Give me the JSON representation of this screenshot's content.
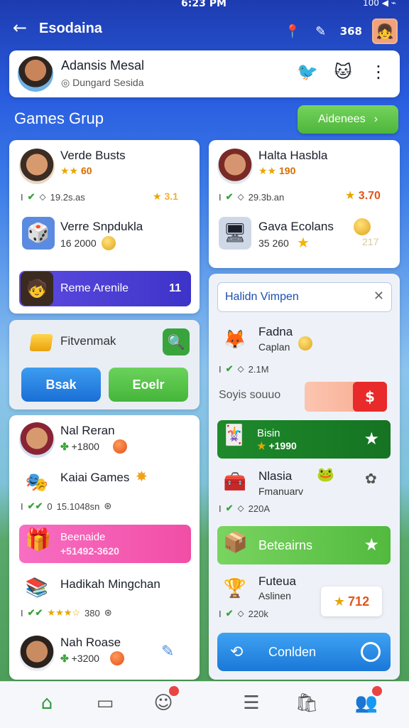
{
  "status_bar": {
    "time": "6:23 PM",
    "right": "100 ◀ ⌁"
  },
  "appbar": {
    "title": "Esodaina",
    "count": "368"
  },
  "profile": {
    "name": "Adansis Mesal",
    "subtitle": "Dungard Sesida"
  },
  "section": {
    "title": "Games Grup",
    "see_all_label": "Aidenees"
  },
  "left_card1": {
    "user1": {
      "name": "Verde Busts",
      "rating": "60",
      "meta": "19.2s.as",
      "score": "3.1"
    },
    "item2": {
      "name": "Verre Snpdukla",
      "value": "16 2000"
    },
    "button": {
      "label": "Reme Arenile",
      "count": "11"
    }
  },
  "right_card1": {
    "user1": {
      "name": "Halta Hasbla",
      "rating": "190",
      "meta": "29.3b.an",
      "score": "3.70"
    },
    "item2": {
      "name": "Gava Ecolans",
      "value": "35 260",
      "score": "217"
    }
  },
  "search_card": {
    "label": "Fitvenmak",
    "btn_blue": "Bsak",
    "btn_green": "Eoelr"
  },
  "left_card2": {
    "user1": {
      "name": "Nal Reran",
      "value": "+1800"
    },
    "item2": {
      "name": "Kaiai Games",
      "meta": "15.1048sn"
    },
    "banner": {
      "title": "Beenaide",
      "sub": "+51492-3620"
    },
    "item3": {
      "name": "Hadikah Mingchan",
      "meta": "380"
    },
    "user2": {
      "name": "Nah Roase",
      "value": "+3200"
    }
  },
  "right_panel": {
    "search_text": "Halidn Vimpen",
    "item1": {
      "name": "Fadna",
      "sub": "Caplan",
      "meta": "2.1M"
    },
    "toggle_label": "Soyis souuo",
    "green_banner": {
      "title": "Bisin",
      "sub": "+1990"
    },
    "item2": {
      "name": "Nlasia",
      "sub": "Fmanuarv",
      "meta": "220A"
    },
    "lime_label": "Beteairns",
    "item3": {
      "name": "Futeua",
      "sub": "Aslinen",
      "meta": "220k"
    },
    "score": "712",
    "blue_button": "Conlden"
  },
  "colors": {
    "accent_green": "#4eb53b",
    "accent_blue": "#1a6fd6",
    "accent_purple": "#3d33c8",
    "accent_pink": "#f24ea6",
    "accent_red": "#e82a2a"
  }
}
